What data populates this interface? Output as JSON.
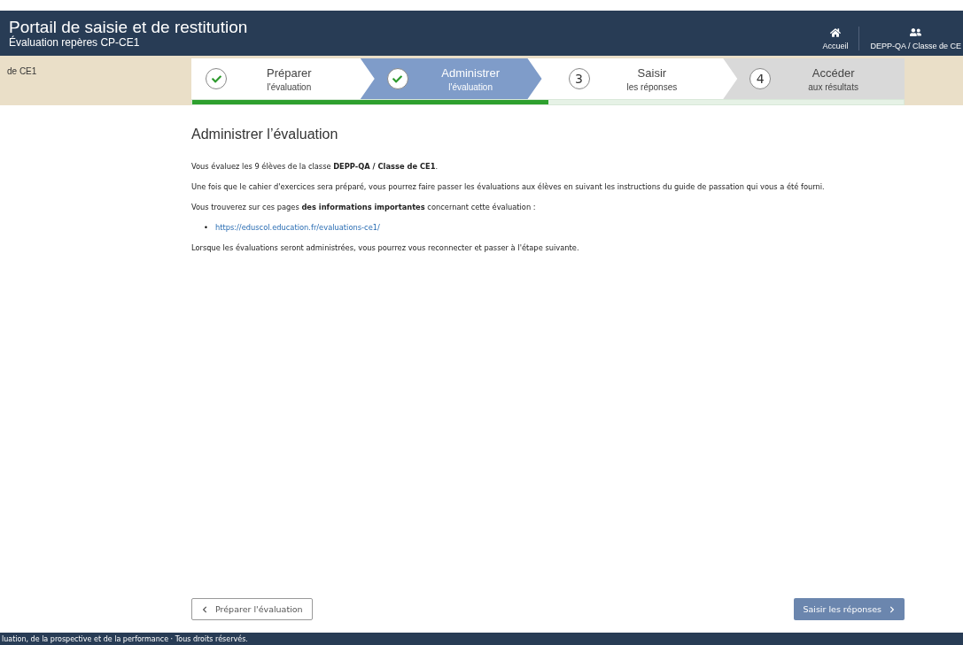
{
  "header": {
    "title": "Portail de saisie et de restitution",
    "subtitle": "Évaluation repères CP-CE1",
    "nav": [
      {
        "label": "Accueil"
      },
      {
        "label": "DEPP-QA / Classe de CE"
      }
    ]
  },
  "breadcrumb": "de CE1",
  "steps": [
    {
      "done": true,
      "title": "Préparer",
      "subtitle": "l'évaluation",
      "selected": false,
      "disabled": false
    },
    {
      "done": true,
      "title": "Administrer",
      "subtitle": "l'évaluation",
      "selected": true,
      "disabled": false
    },
    {
      "done": false,
      "number": "3",
      "title": "Saisir",
      "subtitle": "les réponses",
      "selected": false,
      "disabled": false
    },
    {
      "done": false,
      "number": "4",
      "title": "Accéder",
      "subtitle": "aux résultats",
      "selected": false,
      "disabled": true
    }
  ],
  "progress": {
    "level": 0.5
  },
  "heading": "Administrer l’évaluation",
  "paragraphs": [
    "Vous évaluez les 9 élèves de la classe **DEPP-QA / Classe de CE1**.",
    "Une fois que le cahier d'exercices sera préparé, vous pourrez faire passer les évaluations aux élèves en suivant les instructions du guide de passation qui vous a été fourni.",
    "Vous trouverez sur ces pages **des informations importantes** concernant cette évaluation :"
  ],
  "links": [
    {
      "bullet": "•",
      "url": "https://eduscol.education.fr/evaluations-ce1/"
    }
  ],
  "closing": "Lorsque les évaluations seront administrées, vous pourrez vous reconnecter et passer à l'étape suivante.",
  "buttons": {
    "previous": "Préparer l'évaluation",
    "next": "Saisir les réponses"
  },
  "footer": "luation, de la prospective et de la performance · Tous droits réservés."
}
